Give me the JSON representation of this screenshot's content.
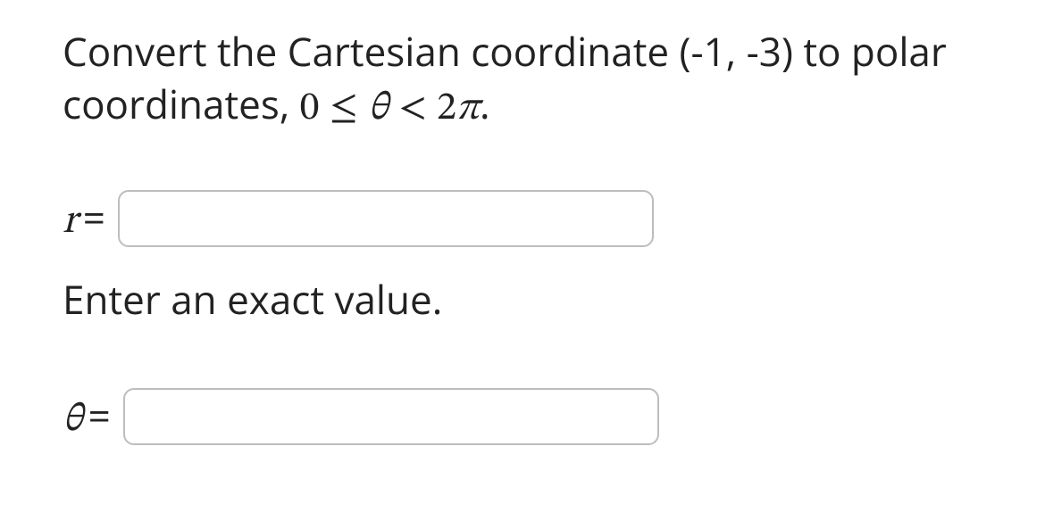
{
  "question": {
    "text_before_point": "Convert the Cartesian coordinate ",
    "point": "(-1, -3)",
    "text_after_point": " to polar coordinates, ",
    "range_lhs_num": "0",
    "range_op1": "≤",
    "range_var": "θ",
    "range_op2": "<",
    "range_rhs_coef": "2",
    "range_rhs_pi": "π",
    "period": "."
  },
  "fields": {
    "r": {
      "var": "r",
      "equals": "=",
      "value": ""
    },
    "theta": {
      "var": "θ",
      "equals": "=",
      "value": ""
    }
  },
  "hint": "Enter an exact value."
}
